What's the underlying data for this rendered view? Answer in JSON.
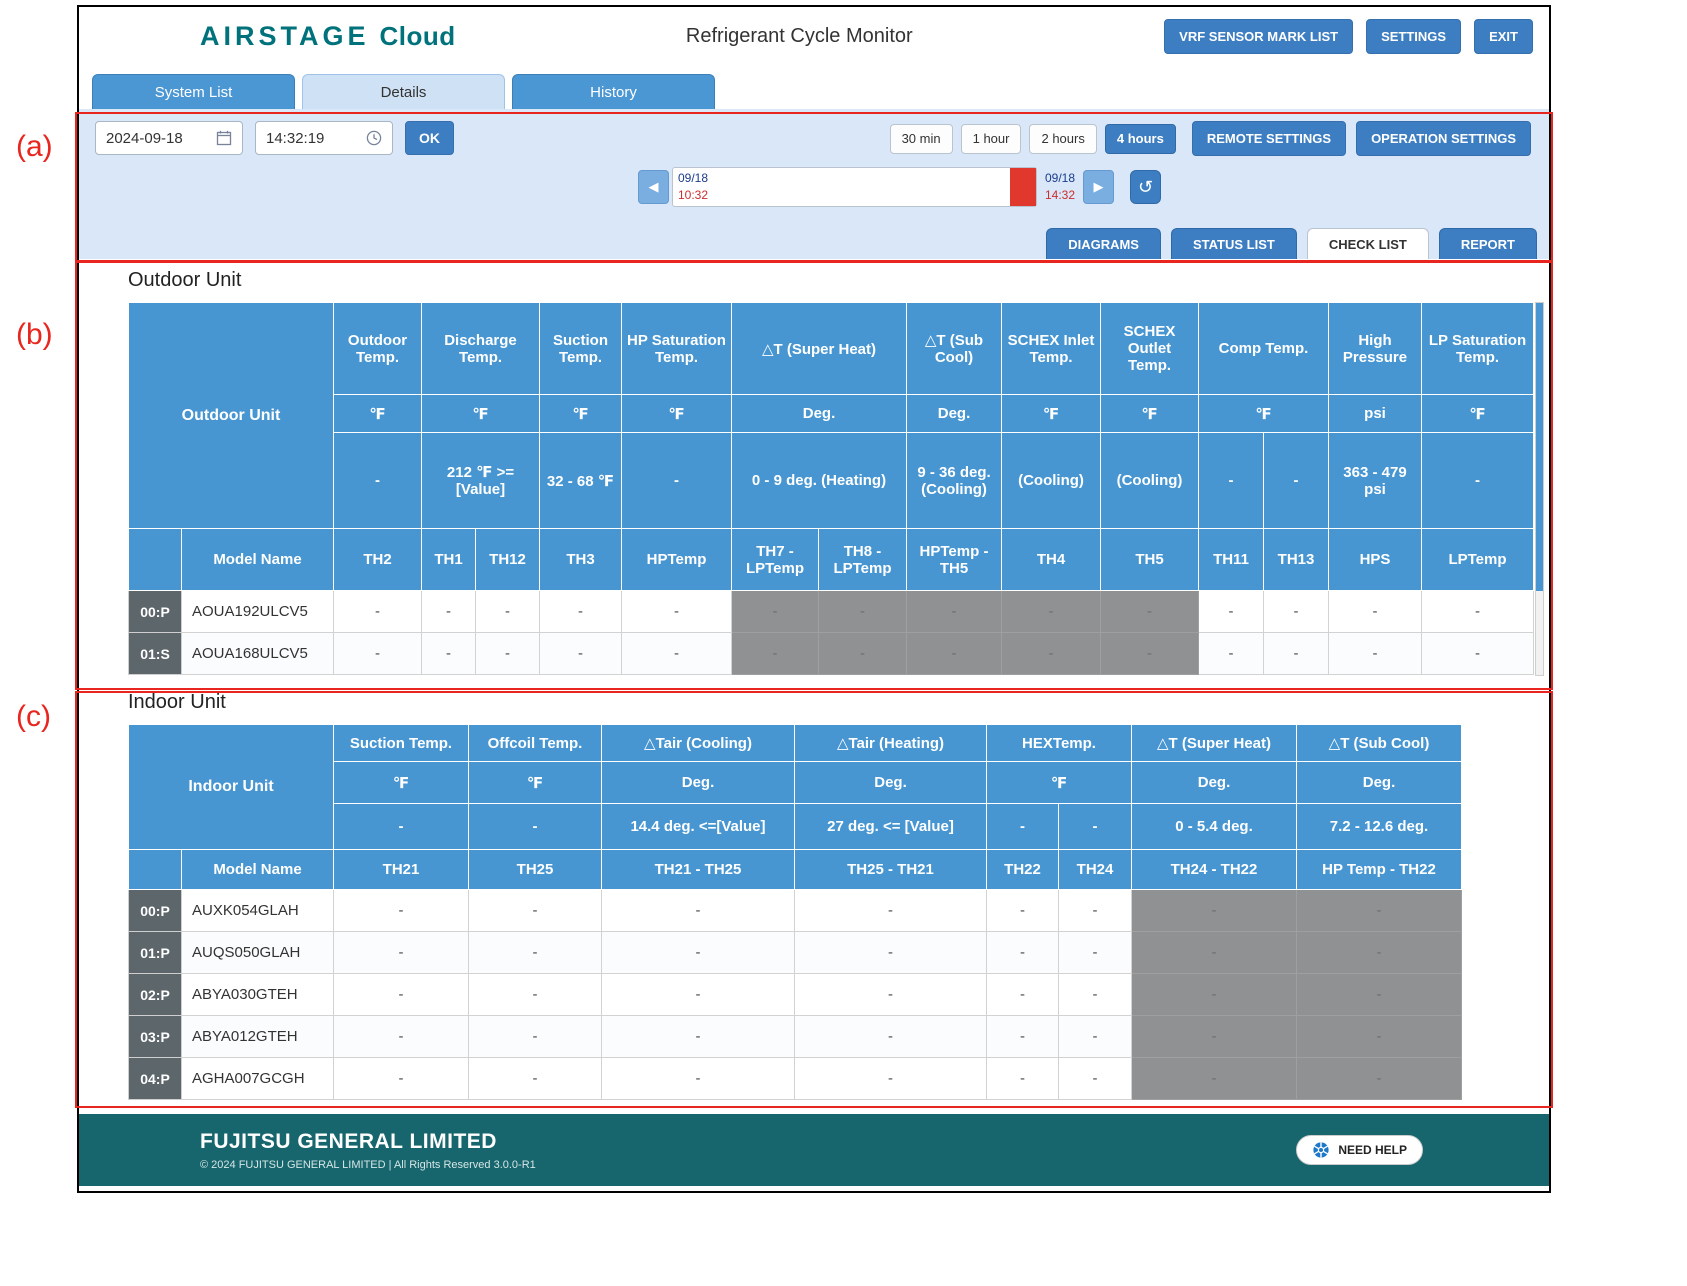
{
  "annotations": {
    "a": "(a)",
    "b": "(b)",
    "c": "(c)"
  },
  "header": {
    "logo_primary": "AIRSTAGE",
    "logo_secondary": "Cloud",
    "title": "Refrigerant Cycle Monitor",
    "vrf_button": "VRF SENSOR MARK LIST",
    "settings_button": "SETTINGS",
    "exit_button": "EXIT"
  },
  "nav_tabs": [
    {
      "label": "System List",
      "active": false
    },
    {
      "label": "Details",
      "active": true
    },
    {
      "label": "History",
      "active": false
    }
  ],
  "controls": {
    "date_value": "2024-09-18",
    "time_value": "14:32:19",
    "ok_button": "OK",
    "range_buttons": [
      "30 min",
      "1 hour",
      "2 hours",
      "4 hours"
    ],
    "active_range": "4 hours",
    "remote_settings_button": "REMOTE SETTINGS",
    "operation_settings_button": "OPERATION SETTINGS",
    "timeline": {
      "start_date": "09/18",
      "start_time": "10:32",
      "end_date": "09/18",
      "end_time": "14:32"
    },
    "view_tabs": [
      "DIAGRAMS",
      "STATUS LIST",
      "CHECK LIST",
      "REPORT"
    ],
    "active_view": "CHECK LIST"
  },
  "icons": {
    "back_arrow": "◀",
    "forward_arrow": "▶",
    "refresh": "↺"
  },
  "outdoor": {
    "section_title": "Outdoor Unit",
    "corner_label": "Outdoor Unit",
    "model_header": "Model Name",
    "groups": [
      {
        "label": "Outdoor Temp.",
        "unit": "℉",
        "ranges": [
          "-"
        ],
        "sensors": [
          "TH2"
        ]
      },
      {
        "label": "Discharge Temp.",
        "unit": "℉",
        "ranges": [
          "212 ℉ >= [Value]"
        ],
        "sensors": [
          "TH1",
          "TH12"
        ]
      },
      {
        "label": "Suction Temp.",
        "unit": "℉",
        "ranges": [
          "32 - 68 ℉"
        ],
        "sensors": [
          "TH3"
        ]
      },
      {
        "label": "HP Saturation Temp.",
        "unit": "℉",
        "ranges": [
          "-"
        ],
        "sensors": [
          "HPTemp"
        ]
      },
      {
        "label": "△T (Super Heat)",
        "unit": "Deg.",
        "ranges": [
          "0 - 9 deg. (Heating)"
        ],
        "sensors": [
          "TH7 - LPTemp",
          "TH8 - LPTemp"
        ]
      },
      {
        "label": "△T (Sub Cool)",
        "unit": "Deg.",
        "ranges": [
          "9 - 36 deg. (Cooling)"
        ],
        "sensors": [
          "HPTemp - TH5"
        ]
      },
      {
        "label": "SCHEX Inlet Temp.",
        "unit": "℉",
        "ranges": [
          "(Cooling)"
        ],
        "sensors": [
          "TH4"
        ]
      },
      {
        "label": "SCHEX Outlet Temp.",
        "unit": "℉",
        "ranges": [
          "(Cooling)"
        ],
        "sensors": [
          "TH5"
        ]
      },
      {
        "label": "Comp Temp.",
        "unit": "℉",
        "ranges": [
          "-",
          "-"
        ],
        "sensors": [
          "TH11",
          "TH13"
        ]
      },
      {
        "label": "High Pressure",
        "unit": "psi",
        "ranges": [
          "363 - 479 psi"
        ],
        "sensors": [
          "HPS"
        ]
      },
      {
        "label": "LP Saturation Temp.",
        "unit": "℉",
        "ranges": [
          "-"
        ],
        "sensors": [
          "LPTemp"
        ]
      }
    ],
    "gray_columns": [
      5,
      6,
      7,
      8,
      9
    ],
    "rows": [
      {
        "id": "00:P",
        "model": "AOUA192ULCV5",
        "values": [
          "-",
          "-",
          "-",
          "-",
          "-",
          "-",
          "-",
          "-",
          "-",
          "-",
          "-",
          "-",
          "-",
          "-"
        ]
      },
      {
        "id": "01:S",
        "model": "AOUA168ULCV5",
        "values": [
          "-",
          "-",
          "-",
          "-",
          "-",
          "-",
          "-",
          "-",
          "-",
          "-",
          "-",
          "-",
          "-",
          "-"
        ]
      }
    ]
  },
  "indoor": {
    "section_title": "Indoor Unit",
    "corner_label": "Indoor Unit",
    "model_header": "Model Name",
    "groups": [
      {
        "label": "Suction Temp.",
        "unit": "℉",
        "ranges": [
          "-"
        ],
        "sensors": [
          "TH21"
        ]
      },
      {
        "label": "Offcoil Temp.",
        "unit": "℉",
        "ranges": [
          "-"
        ],
        "sensors": [
          "TH25"
        ]
      },
      {
        "label": "△Tair (Cooling)",
        "unit": "Deg.",
        "ranges": [
          "14.4 deg. <=[Value]"
        ],
        "sensors": [
          "TH21 - TH25"
        ]
      },
      {
        "label": "△Tair (Heating)",
        "unit": "Deg.",
        "ranges": [
          "27 deg. <= [Value]"
        ],
        "sensors": [
          "TH25 - TH21"
        ]
      },
      {
        "label": "HEXTemp.",
        "unit": "℉",
        "ranges": [
          "-",
          "-"
        ],
        "sensors": [
          "TH22",
          "TH24"
        ]
      },
      {
        "label": "△T (Super Heat)",
        "unit": "Deg.",
        "ranges": [
          "0 - 5.4 deg."
        ],
        "sensors": [
          "TH24 - TH22"
        ]
      },
      {
        "label": "△T (Sub Cool)",
        "unit": "Deg.",
        "ranges": [
          "7.2 - 12.6 deg."
        ],
        "sensors": [
          "HP Temp - TH22"
        ]
      }
    ],
    "gray_columns": [
      6,
      7
    ],
    "rows": [
      {
        "id": "00:P",
        "model": "AUXK054GLAH",
        "values": [
          "-",
          "-",
          "-",
          "-",
          "-",
          "-",
          "-",
          "-"
        ]
      },
      {
        "id": "01:P",
        "model": "AUQS050GLAH",
        "values": [
          "-",
          "-",
          "-",
          "-",
          "-",
          "-",
          "-",
          "-"
        ]
      },
      {
        "id": "02:P",
        "model": "ABYA030GTEH",
        "values": [
          "-",
          "-",
          "-",
          "-",
          "-",
          "-",
          "-",
          "-"
        ]
      },
      {
        "id": "03:P",
        "model": "ABYA012GTEH",
        "values": [
          "-",
          "-",
          "-",
          "-",
          "-",
          "-",
          "-",
          "-"
        ]
      },
      {
        "id": "04:P",
        "model": "AGHA007GCGH",
        "values": [
          "-",
          "-",
          "-",
          "-",
          "-",
          "-",
          "-",
          "-"
        ]
      }
    ]
  },
  "footer": {
    "company": "FUJITSU GENERAL LIMITED",
    "copyright": "© 2024 FUJITSU GENERAL LIMITED | All Rights Reserved 3.0.0-R1",
    "help_button": "NEED HELP"
  },
  "colors": {
    "accent_blue": "#3d7ec2",
    "table_header_blue": "#4796d2",
    "panel_blue": "#d9e7f8",
    "footer_teal": "#17666d",
    "brand_teal": "#00727c",
    "annotation_red": "#e8251f",
    "timeline_handle_red": "#e0382c",
    "gray_cell": "#8f9192"
  }
}
